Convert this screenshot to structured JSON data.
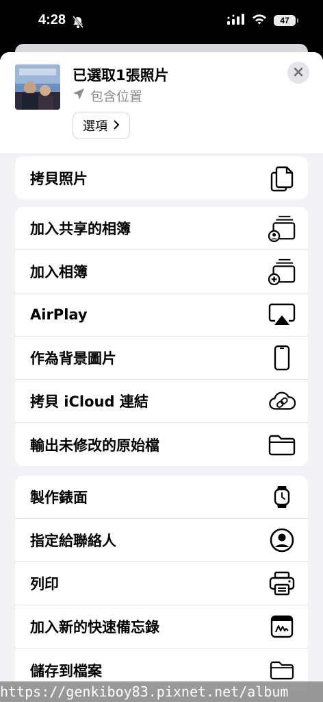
{
  "status": {
    "time": "4:28",
    "battery": "47"
  },
  "header": {
    "title": "已選取1張照片",
    "subtitle": "包含位置",
    "options_label": "選項"
  },
  "groups": [
    {
      "items": [
        {
          "label": "拷貝照片",
          "icon": "copy-icon"
        }
      ]
    },
    {
      "items": [
        {
          "label": "加入共享的相簿",
          "icon": "shared-album-icon"
        },
        {
          "label": "加入相簿",
          "icon": "add-album-icon"
        },
        {
          "label": "AirPlay",
          "icon": "airplay-icon"
        },
        {
          "label": "作為背景圖片",
          "icon": "phone-icon"
        },
        {
          "label": "拷貝 iCloud 連結",
          "icon": "icloud-link-icon"
        },
        {
          "label": "輸出未修改的原始檔",
          "icon": "folder-icon"
        }
      ]
    },
    {
      "items": [
        {
          "label": "製作錶面",
          "icon": "watch-icon"
        },
        {
          "label": "指定給聯絡人",
          "icon": "contact-icon"
        },
        {
          "label": "列印",
          "icon": "printer-icon"
        },
        {
          "label": "加入新的快速備忘錄",
          "icon": "quick-note-icon"
        },
        {
          "label": "儲存到檔案",
          "icon": "files-folder-icon"
        }
      ]
    }
  ],
  "watermark": "https://genkiboy83.pixnet.net/album"
}
